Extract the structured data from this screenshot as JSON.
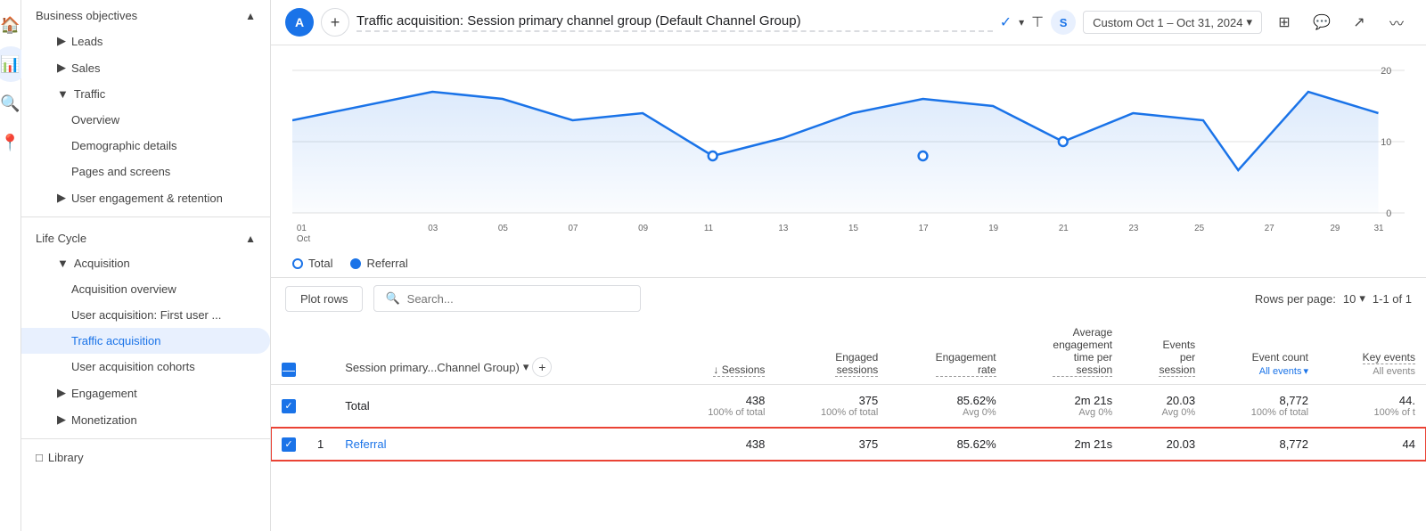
{
  "leftNav": {
    "icons": [
      {
        "name": "home-icon",
        "symbol": "⌂",
        "active": false
      },
      {
        "name": "analytics-icon",
        "symbol": "📊",
        "active": true
      },
      {
        "name": "reports-icon",
        "symbol": "🔍",
        "active": false
      },
      {
        "name": "config-icon",
        "symbol": "📍",
        "active": false
      }
    ]
  },
  "sidebar": {
    "sections": [
      {
        "id": "business-objectives",
        "label": "Business objectives",
        "expanded": true,
        "items": [
          {
            "id": "leads",
            "label": "Leads",
            "hasArrow": true,
            "indent": 1,
            "active": false
          },
          {
            "id": "sales",
            "label": "Sales",
            "hasArrow": true,
            "indent": 1,
            "active": false
          },
          {
            "id": "traffic",
            "label": "Traffic",
            "hasArrow": true,
            "indent": 1,
            "expanded": true,
            "active": false,
            "children": [
              {
                "id": "overview",
                "label": "Overview",
                "indent": 2,
                "active": false
              },
              {
                "id": "demographic-details",
                "label": "Demographic details",
                "indent": 2,
                "active": false
              },
              {
                "id": "pages-screens",
                "label": "Pages and screens",
                "indent": 2,
                "active": false
              }
            ]
          },
          {
            "id": "user-engagement",
            "label": "User engagement & retention",
            "hasArrow": true,
            "indent": 1,
            "active": false
          }
        ]
      },
      {
        "id": "life-cycle",
        "label": "Life Cycle",
        "expanded": true,
        "items": [
          {
            "id": "acquisition",
            "label": "Acquisition",
            "hasArrow": true,
            "indent": 1,
            "expanded": true,
            "active": false,
            "children": [
              {
                "id": "acquisition-overview",
                "label": "Acquisition overview",
                "indent": 2,
                "active": false
              },
              {
                "id": "user-acquisition",
                "label": "User acquisition: First user ...",
                "indent": 2,
                "active": false
              },
              {
                "id": "traffic-acquisition",
                "label": "Traffic acquisition",
                "indent": 2,
                "active": true
              },
              {
                "id": "user-acquisition-cohorts",
                "label": "User acquisition cohorts",
                "indent": 2,
                "active": false
              }
            ]
          },
          {
            "id": "engagement",
            "label": "Engagement",
            "hasArrow": true,
            "indent": 1,
            "active": false
          },
          {
            "id": "monetization",
            "label": "Monetization",
            "hasArrow": true,
            "indent": 1,
            "active": false
          }
        ]
      },
      {
        "id": "library-section",
        "label": "",
        "items": [
          {
            "id": "library",
            "label": "Library",
            "hasIcon": true,
            "indent": 0,
            "active": false
          }
        ]
      }
    ]
  },
  "topbar": {
    "avatar": "A",
    "title": "Traffic acquisition: Session primary channel group (Default Channel Group)",
    "check_icon": "✓",
    "date_range": "Custom  Oct 1 – Oct 31, 2024",
    "filter_label": "S"
  },
  "chart": {
    "x_labels": [
      "01\nOct",
      "03",
      "05",
      "07",
      "09",
      "11",
      "13",
      "15",
      "17",
      "19",
      "21",
      "23",
      "25",
      "27",
      "29",
      "31"
    ],
    "y_labels": [
      "20",
      "10",
      "0"
    ],
    "legend": [
      {
        "id": "total",
        "label": "Total",
        "filled": false
      },
      {
        "id": "referral",
        "label": "Referral",
        "filled": true
      }
    ]
  },
  "table_controls": {
    "plot_rows_label": "Plot rows",
    "search_placeholder": "Search...",
    "rows_per_page_label": "Rows per page:",
    "rows_per_page_value": "10",
    "pagination": "1-1 of 1"
  },
  "table": {
    "column_selector_label": "Session primary...Channel Group)",
    "columns": [
      {
        "id": "sessions",
        "label": "↓ Sessions",
        "sublabel": ""
      },
      {
        "id": "engaged-sessions",
        "label": "Engaged",
        "label2": "sessions",
        "sublabel": ""
      },
      {
        "id": "engagement-rate",
        "label": "Engagement",
        "label2": "rate",
        "sublabel": ""
      },
      {
        "id": "avg-engagement",
        "label": "Average",
        "label2": "engagement",
        "label3": "time per",
        "label4": "session",
        "sublabel": ""
      },
      {
        "id": "events-per-session",
        "label": "Events",
        "label2": "per",
        "label3": "session",
        "sublabel": ""
      },
      {
        "id": "event-count",
        "label": "Event count",
        "label2": "All events ▾",
        "sublabel": ""
      },
      {
        "id": "key-events",
        "label": "Key events",
        "label2": "All events",
        "sublabel": ""
      }
    ],
    "total_row": {
      "label": "Total",
      "sessions": "438",
      "sessions_sub": "100% of total",
      "engaged_sessions": "375",
      "engaged_sessions_sub": "100% of total",
      "engagement_rate": "85.62%",
      "engagement_rate_sub": "Avg 0%",
      "avg_engagement": "2m 21s",
      "avg_engagement_sub": "Avg 0%",
      "events_per_session": "20.03",
      "events_per_session_sub": "Avg 0%",
      "event_count": "8,772",
      "event_count_sub": "100% of total",
      "key_events": "44.",
      "key_events_sub": "100% of t"
    },
    "rows": [
      {
        "num": "1",
        "label": "Referral",
        "sessions": "438",
        "engaged_sessions": "375",
        "engagement_rate": "85.62%",
        "avg_engagement": "2m 21s",
        "events_per_session": "20.03",
        "event_count": "8,772",
        "key_events": "44",
        "selected": true
      }
    ]
  }
}
